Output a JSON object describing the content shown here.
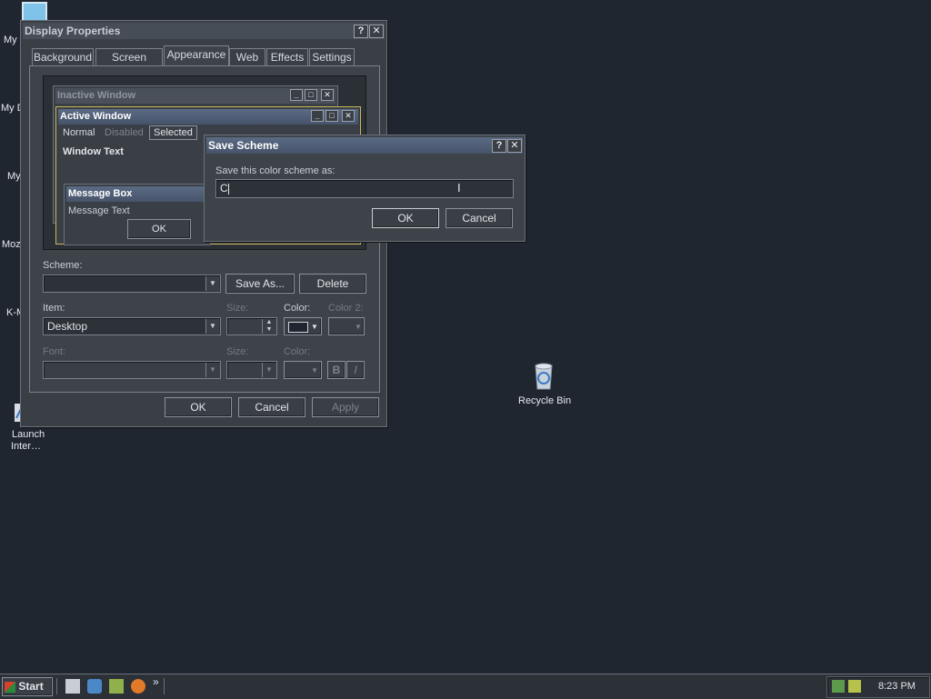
{
  "desktop": {
    "labels": [
      "My",
      "My D",
      "My",
      "Moz",
      "K-M"
    ],
    "launch": [
      "Launch",
      "Inter…"
    ],
    "recycle_bin": "Recycle Bin"
  },
  "display_properties": {
    "title": "Display Properties",
    "tabs": [
      "Background",
      "Screen Saver",
      "Appearance",
      "Web",
      "Effects",
      "Settings"
    ],
    "selected_tab": "Appearance",
    "preview": {
      "inactive_title": "Inactive Window",
      "active_title": "Active Window",
      "menu_normal": "Normal",
      "menu_disabled": "Disabled",
      "menu_selected": "Selected",
      "window_text": "Window Text",
      "message_box_title": "Message Box",
      "message_text": "Message Text",
      "ok": "OK"
    },
    "scheme_label": "Scheme:",
    "scheme_value": "",
    "save_as": "Save As...",
    "delete": "Delete",
    "item_label": "Item:",
    "item_value": "Desktop",
    "size_label": "Size:",
    "color_label": "Color:",
    "color2_label": "Color 2:",
    "font_label": "Font:",
    "font_size_label": "Size:",
    "font_color_label": "Color:",
    "bold": "B",
    "italic": "I",
    "ok": "OK",
    "cancel": "Cancel",
    "apply": "Apply"
  },
  "save_scheme": {
    "title": "Save Scheme",
    "prompt": "Save this color scheme as:",
    "input_value": "C",
    "ok": "OK",
    "cancel": "Cancel"
  },
  "taskbar": {
    "start": "Start",
    "chevron": "»",
    "clock": "8:23 PM"
  }
}
